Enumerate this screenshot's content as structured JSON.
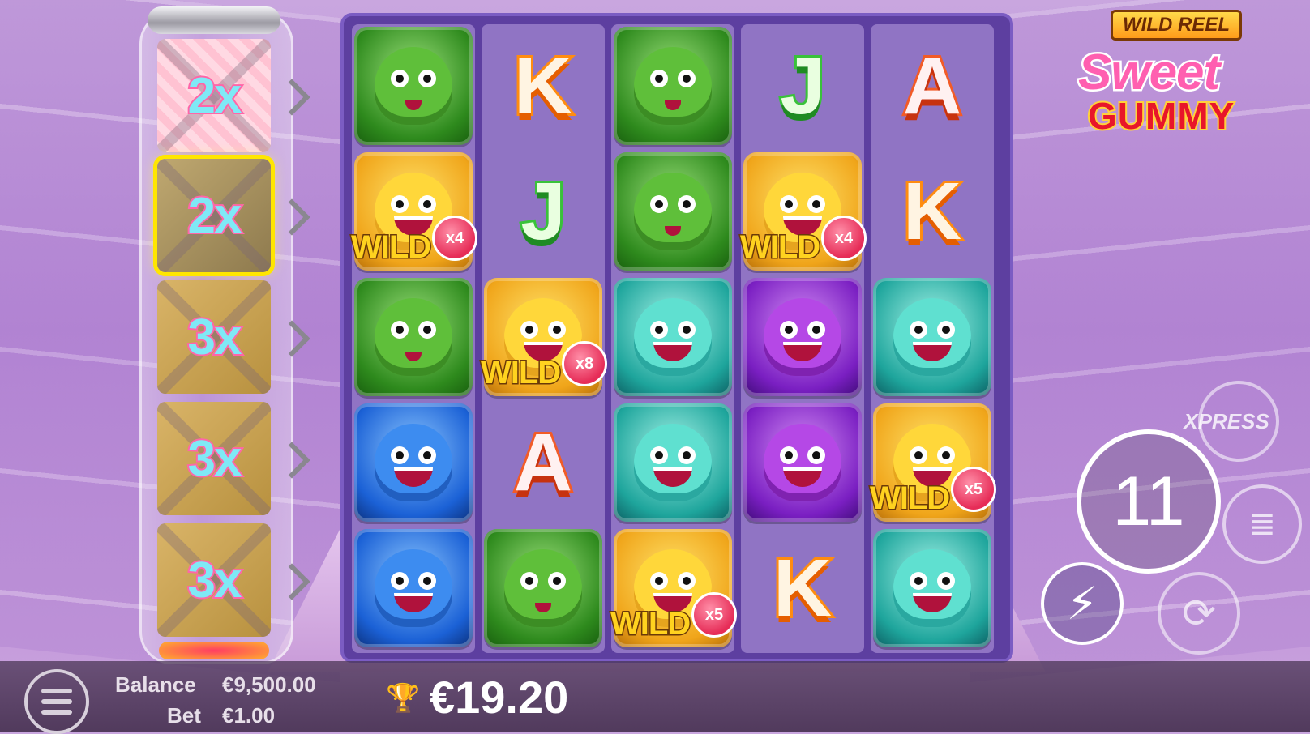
{
  "game": {
    "logo_top": "WILD REEL",
    "logo_line1": "Sweet",
    "logo_line2": "GUMMY"
  },
  "multipliers": [
    "2x",
    "2x",
    "3x",
    "3x",
    "3x"
  ],
  "active_multiplier_index": 1,
  "grid": [
    [
      {
        "type": "monster",
        "color": "green",
        "icon": "green-gremlin-icon"
      },
      {
        "type": "wild",
        "color": "yellow",
        "icon": "yellow-wild-icon",
        "label": "WILD",
        "mult": "x4"
      },
      {
        "type": "monster",
        "color": "green",
        "icon": "green-gremlin-icon"
      },
      {
        "type": "monster",
        "color": "blue",
        "icon": "blue-monster-icon"
      },
      {
        "type": "monster",
        "color": "blue",
        "icon": "blue-monster-icon"
      }
    ],
    [
      {
        "type": "letter",
        "letter": "K"
      },
      {
        "type": "letter",
        "letter": "J"
      },
      {
        "type": "wild",
        "color": "yellow",
        "icon": "yellow-wild-icon",
        "label": "WILD",
        "mult": "x8"
      },
      {
        "type": "letter",
        "letter": "A"
      },
      {
        "type": "monster",
        "color": "green",
        "icon": "green-gremlin-icon"
      }
    ],
    [
      {
        "type": "monster",
        "color": "green",
        "icon": "green-gremlin-icon"
      },
      {
        "type": "monster",
        "color": "green",
        "icon": "green-gremlin-icon"
      },
      {
        "type": "monster",
        "color": "teal",
        "icon": "teal-monster-icon"
      },
      {
        "type": "monster",
        "color": "teal",
        "icon": "teal-monster-icon"
      },
      {
        "type": "wild",
        "color": "yellow",
        "icon": "yellow-wild-icon",
        "label": "WILD",
        "mult": "x5"
      }
    ],
    [
      {
        "type": "letter",
        "letter": "J"
      },
      {
        "type": "wild",
        "color": "yellow",
        "icon": "yellow-wild-icon",
        "label": "WILD",
        "mult": "x4"
      },
      {
        "type": "monster",
        "color": "purple",
        "icon": "purple-monster-icon"
      },
      {
        "type": "monster",
        "color": "purple",
        "icon": "purple-monster-icon"
      },
      {
        "type": "letter",
        "letter": "K"
      }
    ],
    [
      {
        "type": "letter",
        "letter": "A"
      },
      {
        "type": "letter",
        "letter": "K"
      },
      {
        "type": "monster",
        "color": "teal",
        "icon": "teal-monster-icon"
      },
      {
        "type": "wild",
        "color": "yellow",
        "icon": "yellow-wild-icon",
        "label": "WILD",
        "mult": "x5"
      },
      {
        "type": "monster",
        "color": "teal",
        "icon": "teal-monster-icon"
      }
    ]
  ],
  "controls": {
    "xpress_label": "XPRESS",
    "spin_count": "11",
    "coins_icon": "coin-stack-icon",
    "turbo_icon": "lightning-icon",
    "auto_label": "AUTO",
    "auto_icon": "autoplay-icon"
  },
  "footer": {
    "balance_label": "Balance",
    "balance_value": "€9,500.00",
    "bet_label": "Bet",
    "bet_value": "€1.00",
    "win_amount": "€19.20",
    "menu_icon": "hamburger-menu-icon",
    "trophy_icon": "trophy-icon"
  }
}
